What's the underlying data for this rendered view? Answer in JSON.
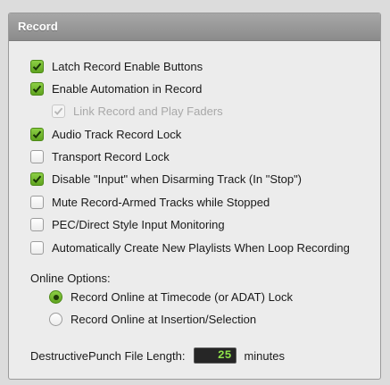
{
  "panel": {
    "title": "Record"
  },
  "options": [
    {
      "label": "Latch Record Enable Buttons",
      "checked": true,
      "disabled": false,
      "indent": false
    },
    {
      "label": "Enable Automation in Record",
      "checked": true,
      "disabled": false,
      "indent": false
    },
    {
      "label": "Link Record and Play Faders",
      "checked": true,
      "disabled": true,
      "indent": true
    },
    {
      "label": "Audio Track Record Lock",
      "checked": true,
      "disabled": false,
      "indent": false
    },
    {
      "label": "Transport Record Lock",
      "checked": false,
      "disabled": false,
      "indent": false
    },
    {
      "label": "Disable \"Input\" when Disarming Track (In \"Stop\")",
      "checked": true,
      "disabled": false,
      "indent": false
    },
    {
      "label": "Mute Record-Armed Tracks while Stopped",
      "checked": false,
      "disabled": false,
      "indent": false
    },
    {
      "label": "PEC/Direct Style Input Monitoring",
      "checked": false,
      "disabled": false,
      "indent": false
    },
    {
      "label": "Automatically Create New Playlists When Loop Recording",
      "checked": false,
      "disabled": false,
      "indent": false
    }
  ],
  "online_options": {
    "label": "Online Options:",
    "choices": [
      {
        "label": "Record Online at Timecode (or ADAT) Lock",
        "selected": true
      },
      {
        "label": "Record Online at Insertion/Selection",
        "selected": false
      }
    ]
  },
  "punch_length": {
    "label": "DestructivePunch File Length:",
    "value": "25",
    "unit": "minutes"
  },
  "colors": {
    "check_on": "#6db02a",
    "field_text": "#8fe34a",
    "header_bg": "#9a9a9a"
  }
}
